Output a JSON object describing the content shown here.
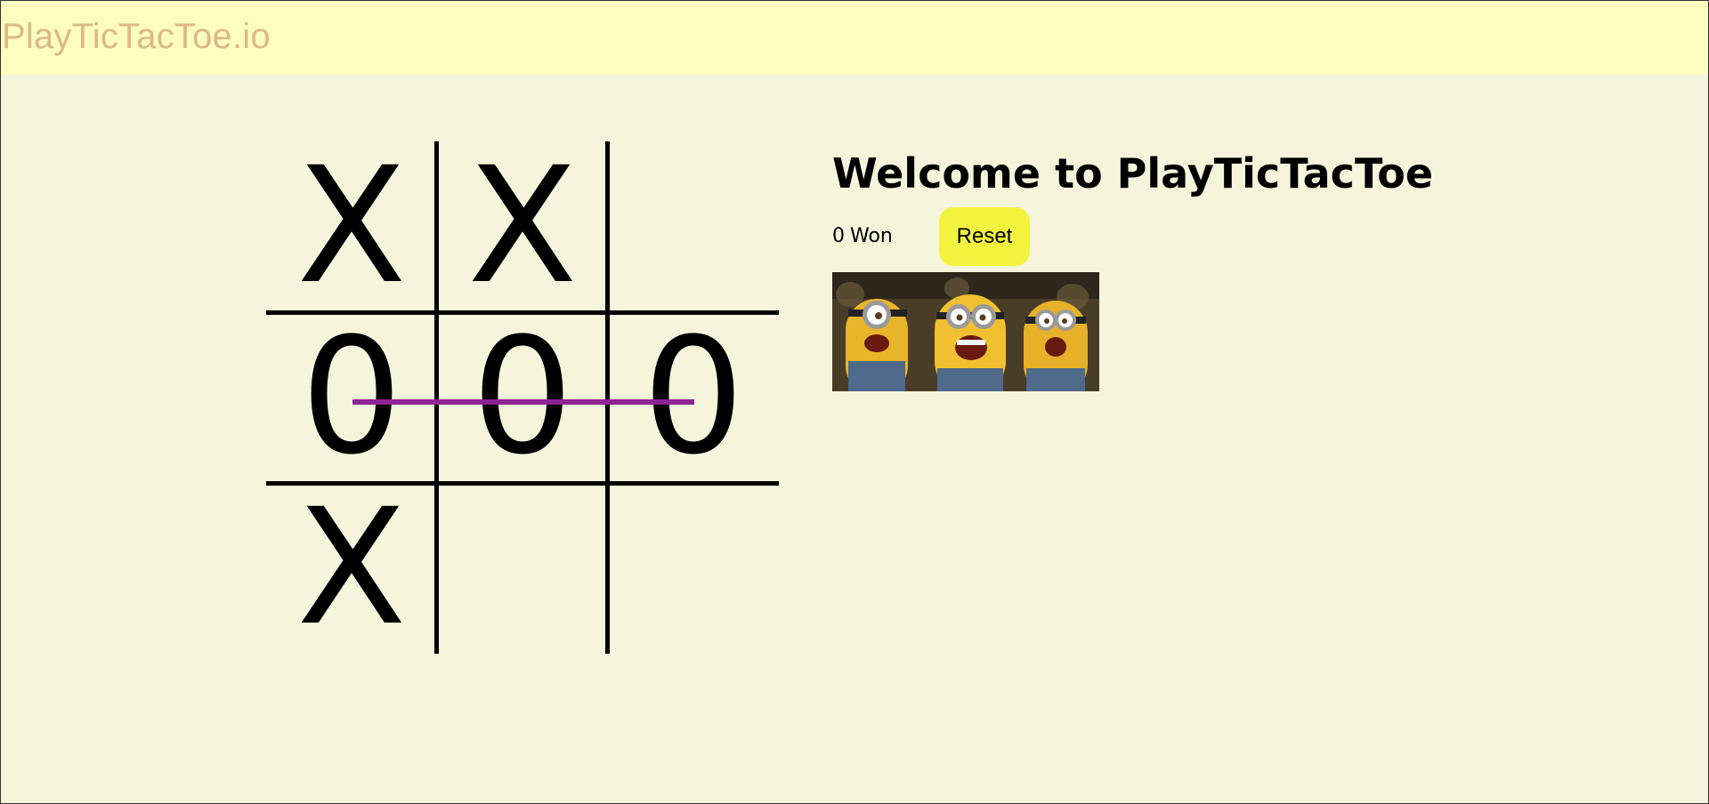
{
  "header": {
    "brand": "PlayTicTacToe.io"
  },
  "board": {
    "cells": [
      "X",
      "X",
      "",
      "0",
      "0",
      "0",
      "X",
      "",
      ""
    ],
    "winning_line": "middle-row",
    "winning_line_color": "#8b2596"
  },
  "panel": {
    "title": "Welcome to PlayTicTacToe",
    "won_count": "0",
    "won_label": "Won",
    "reset_label": "Reset",
    "reset_color": "#f3f33f"
  },
  "colors": {
    "page_background": "#f5f5dc",
    "header_background": "#fdfdc0",
    "brand_text": "#deb887"
  },
  "image": {
    "subject": "celebrating-minions-gif"
  }
}
